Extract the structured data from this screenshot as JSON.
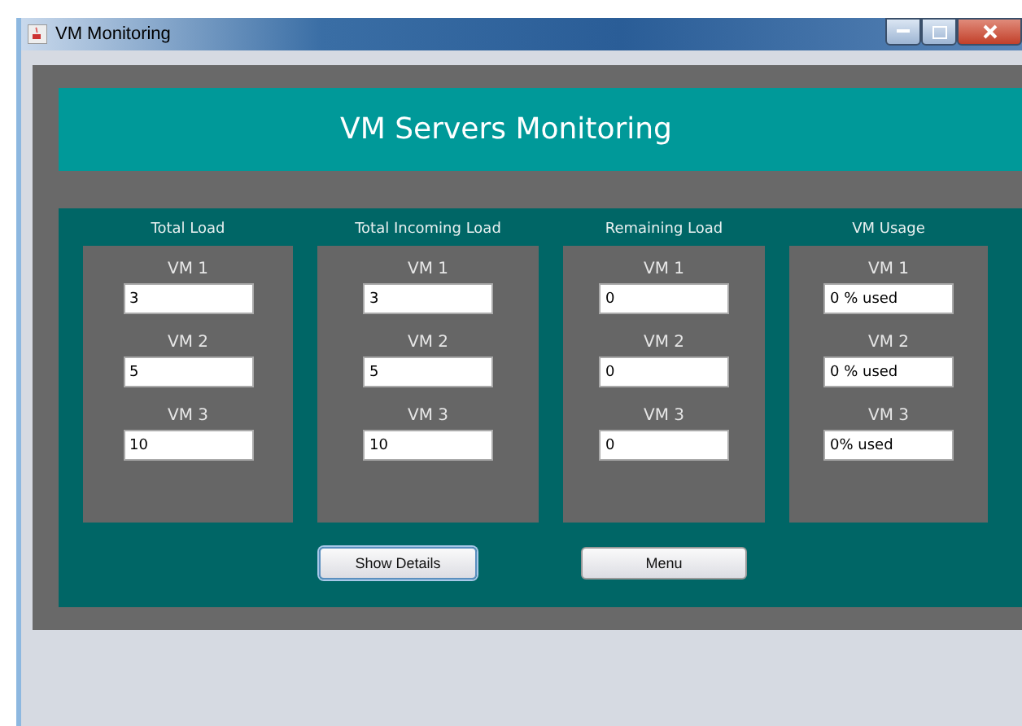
{
  "window": {
    "title": "VM Monitoring"
  },
  "header": {
    "title": "VM Servers Monitoring"
  },
  "columns": [
    {
      "title": "Total Load",
      "fields": [
        {
          "label": "VM 1",
          "value": "3"
        },
        {
          "label": "VM 2",
          "value": "5"
        },
        {
          "label": "VM 3",
          "value": "10"
        }
      ]
    },
    {
      "title": "Total Incoming Load",
      "fields": [
        {
          "label": "VM 1",
          "value": "3"
        },
        {
          "label": "VM 2",
          "value": "5"
        },
        {
          "label": "VM 3",
          "value": "10"
        }
      ]
    },
    {
      "title": "Remaining Load",
      "fields": [
        {
          "label": "VM 1",
          "value": "0"
        },
        {
          "label": "VM 2",
          "value": "0"
        },
        {
          "label": "VM 3",
          "value": "0"
        }
      ]
    },
    {
      "title": "VM Usage",
      "fields": [
        {
          "label": "VM 1",
          "value": "0 % used"
        },
        {
          "label": "VM 2",
          "value": "0 % used"
        },
        {
          "label": "VM 3",
          "value": "0% used"
        }
      ]
    }
  ],
  "buttons": [
    {
      "label": "Show Details",
      "focused": true
    },
    {
      "label": "Menu",
      "focused": false
    }
  ]
}
